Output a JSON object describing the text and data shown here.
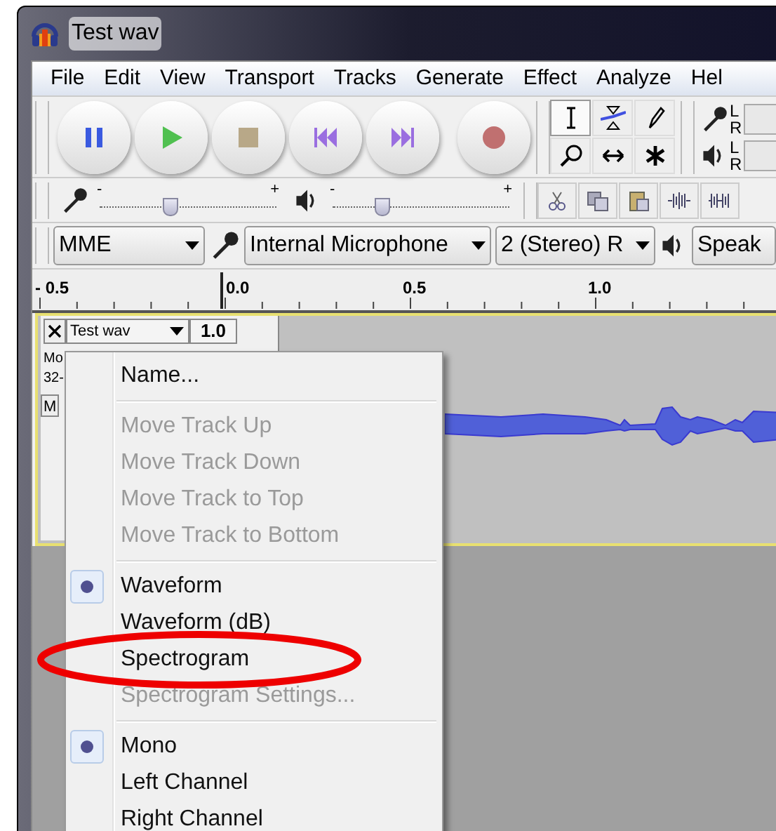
{
  "window": {
    "title": "Test wav"
  },
  "menu_bar": [
    "File",
    "Edit",
    "View",
    "Transport",
    "Tracks",
    "Generate",
    "Effect",
    "Analyze",
    "Hel"
  ],
  "meters": [
    {
      "kind": "record",
      "left": "L",
      "right": "R"
    },
    {
      "kind": "playback",
      "left": "L",
      "right": "R"
    }
  ],
  "mixer": [
    {
      "kind": "input",
      "min_label": "-",
      "max_label": "+",
      "level": 0.4
    },
    {
      "kind": "output",
      "min_label": "-",
      "max_label": "+",
      "level": 0.28
    }
  ],
  "device_toolbar": {
    "host": "MME",
    "input_device": "Internal Microphone",
    "channels": "2 (Stereo) R",
    "output_device": "Speak"
  },
  "ruler": [
    "- 0.5",
    "0.0",
    "0.5",
    "1.0"
  ],
  "track": {
    "name": "Test wav",
    "gain": "1.0",
    "info": [
      "Mo",
      "32-"
    ],
    "mute_button": "M"
  },
  "context_menu": [
    {
      "kind": "command",
      "label": "Name...",
      "disabled": false
    },
    {
      "kind": "separator"
    },
    {
      "kind": "command",
      "label": "Move Track Up",
      "disabled": true
    },
    {
      "kind": "command",
      "label": "Move Track Down",
      "disabled": true
    },
    {
      "kind": "command",
      "label": "Move Track to Top",
      "disabled": true
    },
    {
      "kind": "command",
      "label": "Move Track to Bottom",
      "disabled": true
    },
    {
      "kind": "separator"
    },
    {
      "kind": "radio",
      "label": "Waveform",
      "selected": true
    },
    {
      "kind": "radio",
      "label": "Waveform (dB)",
      "selected": false
    },
    {
      "kind": "radio",
      "label": "Spectrogram",
      "selected": false
    },
    {
      "kind": "command",
      "label": "Spectrogram Settings...",
      "disabled": true
    },
    {
      "kind": "separator"
    },
    {
      "kind": "radio",
      "label": "Mono",
      "selected": true
    },
    {
      "kind": "radio",
      "label": "Left Channel",
      "selected": false
    },
    {
      "kind": "radio",
      "label": "Right Channel",
      "selected": false
    }
  ]
}
